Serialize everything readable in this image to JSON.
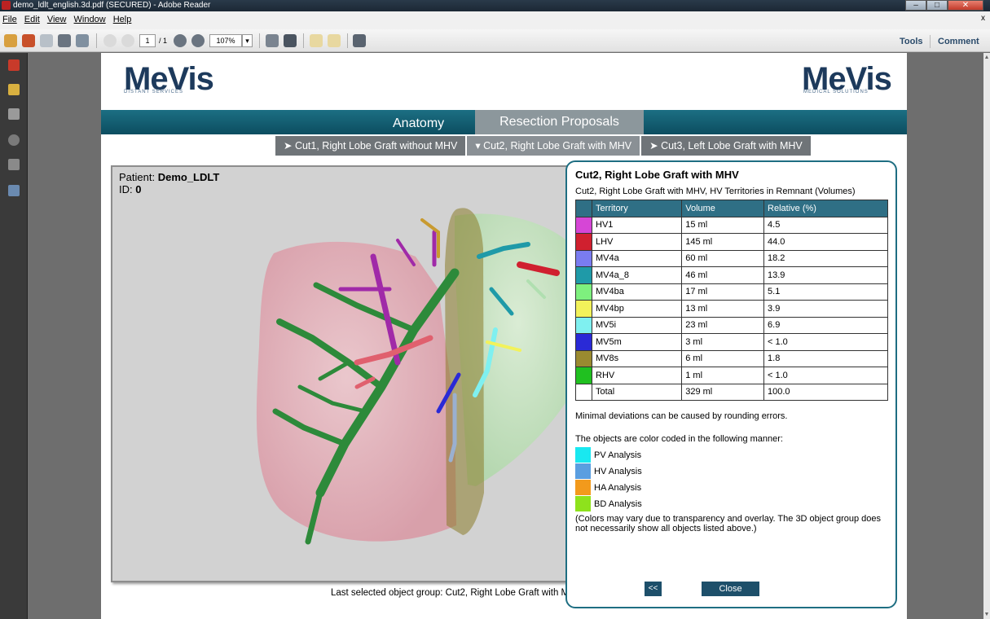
{
  "window": {
    "title": "demo_ldlt_english.3d.pdf (SECURED) - Adobe Reader",
    "close_glyph": "x"
  },
  "menu": [
    "File",
    "Edit",
    "View",
    "Window",
    "Help"
  ],
  "toolbar": {
    "page_current": "1",
    "page_total": "/ 1",
    "zoom": "107%",
    "tools": "Tools",
    "comment": "Comment"
  },
  "logos": {
    "left_name": "MeVis",
    "left_sub": "DISTANT SERVICES",
    "right_name": "MeVis",
    "right_sub": "MEDICAL SOLUTIONS"
  },
  "nav": {
    "tabs": [
      "Anatomy",
      "Resection Proposals"
    ],
    "active_tab": "Resection Proposals"
  },
  "subnav": [
    {
      "label": "➤ Cut1, Right Lobe Graft without MHV",
      "active": false
    },
    {
      "label": "▾ Cut2, Right Lobe Graft with MHV",
      "active": true
    },
    {
      "label": "➤ Cut3, Left Lobe Graft with MHV",
      "active": false
    }
  ],
  "viewer": {
    "patient_prefix": "Patient: ",
    "patient_name": "Demo_LDLT",
    "id_prefix": "ID: ",
    "id_value": "0"
  },
  "last_selected": "Last selected object group:  Cut2, Right Lobe Graft with M",
  "panel": {
    "title": "Cut2, Right Lobe Graft with MHV",
    "table_caption": "Cut2, Right Lobe Graft with MHV, HV Territories in Remnant (Volumes)",
    "columns": [
      "Territory",
      "Volume",
      "Relative (%)"
    ],
    "rows": [
      {
        "color": "#d646d6",
        "territory": "HV1",
        "volume": "15 ml",
        "relative": "4.5"
      },
      {
        "color": "#d0202f",
        "territory": "LHV",
        "volume": "145 ml",
        "relative": "44.0"
      },
      {
        "color": "#7a7cf0",
        "territory": "MV4a",
        "volume": "60 ml",
        "relative": "18.2"
      },
      {
        "color": "#1f9aa8",
        "territory": "MV4a_8",
        "volume": "46 ml",
        "relative": "13.9"
      },
      {
        "color": "#7ef07e",
        "territory": "MV4ba",
        "volume": "17 ml",
        "relative": "5.1"
      },
      {
        "color": "#f2f25a",
        "territory": "MV4bp",
        "volume": "13 ml",
        "relative": "3.9"
      },
      {
        "color": "#7ff0f0",
        "territory": "MV5i",
        "volume": "23 ml",
        "relative": "6.9"
      },
      {
        "color": "#2a2ad6",
        "territory": "MV5m",
        "volume": "3 ml",
        "relative": "< 1.0"
      },
      {
        "color": "#9a8a30",
        "territory": "MV8s",
        "volume": "6 ml",
        "relative": "1.8"
      },
      {
        "color": "#20c020",
        "territory": "RHV",
        "volume": "1 ml",
        "relative": "< 1.0"
      },
      {
        "color": "#ffffff",
        "territory": "Total",
        "volume": "329 ml",
        "relative": "100.0"
      }
    ],
    "rounding_note": "Minimal deviations can be caused by rounding errors.",
    "legend_intro": "The objects are color coded in the following manner:",
    "legend": [
      {
        "color": "#19e8f0",
        "label": "PV Analysis"
      },
      {
        "color": "#5a9ee0",
        "label": "HV Analysis"
      },
      {
        "color": "#f29a1c",
        "label": "HA Analysis"
      },
      {
        "color": "#8ee21c",
        "label": "BD Analysis"
      }
    ],
    "colors_note": "(Colors may vary due to transparency and overlay. The 3D object group does not necessarily show all objects listed above.)",
    "back_label": "<<",
    "close_label": "Close"
  }
}
